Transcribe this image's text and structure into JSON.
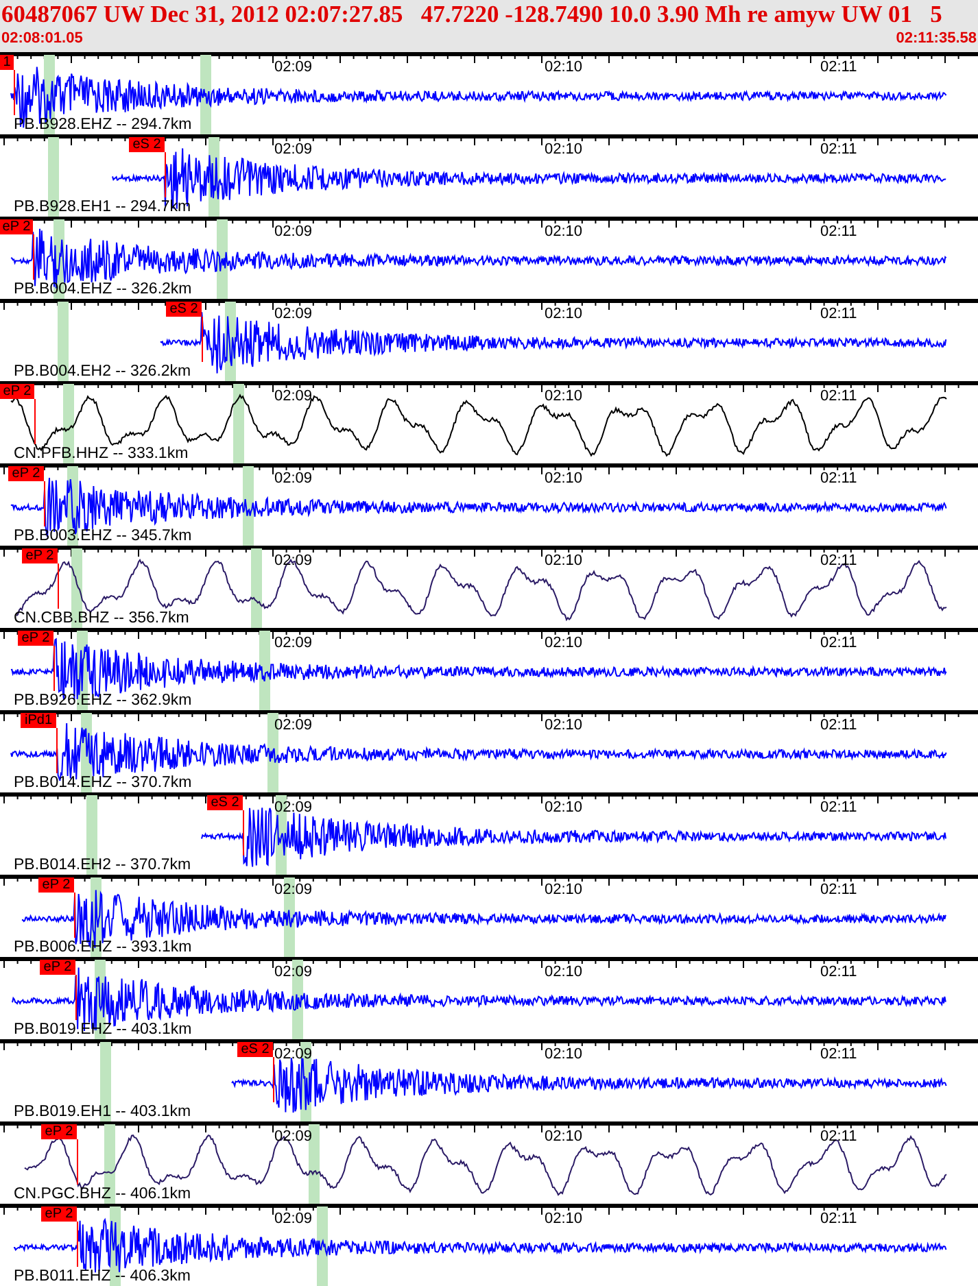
{
  "header": {
    "title": "60487067 UW Dec 31, 2012 02:07:27.85   47.7220 -128.7490 10.0 3.90 Mh re amyw UW 01   5",
    "start_time": "02:08:01.05",
    "end_time": "02:11:35.58"
  },
  "traces": [
    {
      "label": "PB.B928.EHZ -- 294.7km",
      "kind": "noise",
      "color": "#0000ff",
      "ticks": [
        "02:09",
        "02:10",
        "02:11"
      ],
      "pick": "1"
    },
    {
      "label": "PB.B928.EH1 -- 294.7km",
      "kind": "noise",
      "color": "#0000ff",
      "ticks": [
        "02:09",
        "02:10",
        "02:11"
      ],
      "pick": "eS 2"
    },
    {
      "label": "PB.B004.EHZ -- 326.2km",
      "kind": "noise",
      "color": "#0000ff",
      "ticks": [
        "02:09",
        "02:10",
        "02:11"
      ],
      "pick": "eP 2"
    },
    {
      "label": "PB.B004.EH2 -- 326.2km",
      "kind": "noise",
      "color": "#0000ff",
      "ticks": [
        "02:09",
        "02:10",
        "02:11"
      ],
      "pick": "eS 2"
    },
    {
      "label": "CN.PFB.HHZ -- 333.1km",
      "kind": "surface",
      "color": "#000000",
      "ticks": [
        "02:09",
        "02:10",
        "02:11"
      ],
      "pick": "eP 2"
    },
    {
      "label": "PB.B003.EHZ -- 345.7km",
      "kind": "noise",
      "color": "#0000ff",
      "ticks": [
        "02:09",
        "02:10",
        "02:11"
      ],
      "pick": "eP 2"
    },
    {
      "label": "CN.CBB.BHZ -- 356.7km",
      "kind": "surface",
      "color": "#2b1b66",
      "ticks": [
        "02:09",
        "02:10",
        "02:11"
      ],
      "pick": "eP 2"
    },
    {
      "label": "PB.B926.EHZ -- 362.9km",
      "kind": "noise",
      "color": "#0000ff",
      "ticks": [
        "02:09",
        "02:10",
        "02:11"
      ],
      "pick": "eP 2"
    },
    {
      "label": "PB.B014.EHZ -- 370.7km",
      "kind": "noise",
      "color": "#0000ff",
      "ticks": [
        "02:09",
        "02:10",
        "02:11"
      ],
      "pick": "iPd1"
    },
    {
      "label": "PB.B014.EH2 -- 370.7km",
      "kind": "noise",
      "color": "#0000ff",
      "ticks": [
        "02:09",
        "02:10",
        "02:11"
      ],
      "pick": "eS 2"
    },
    {
      "label": "PB.B006.EHZ -- 393.1km",
      "kind": "noise",
      "color": "#0000ff",
      "ticks": [
        "02:09",
        "02:10",
        "02:11"
      ],
      "pick": "eP 2"
    },
    {
      "label": "PB.B019.EHZ -- 403.1km",
      "kind": "noise",
      "color": "#0000ff",
      "ticks": [
        "02:09",
        "02:10",
        "02:11"
      ],
      "pick": "eP 2"
    },
    {
      "label": "PB.B019.EH1 -- 403.1km",
      "kind": "noise",
      "color": "#0000ff",
      "ticks": [
        "02:09",
        "02:10",
        "02:11"
      ],
      "pick": "eS 2"
    },
    {
      "label": "CN.PGC.BHZ -- 406.1km",
      "kind": "surface",
      "color": "#2b1b66",
      "ticks": [
        "02:09",
        "02:10",
        "02:11"
      ],
      "pick": "eP 2"
    },
    {
      "label": "PB.B011.EHZ -- 406.3km",
      "kind": "noise",
      "color": "#0000ff",
      "ticks": [
        "02:09",
        "02:10",
        "02:11"
      ],
      "pick": "eP 2"
    }
  ]
}
